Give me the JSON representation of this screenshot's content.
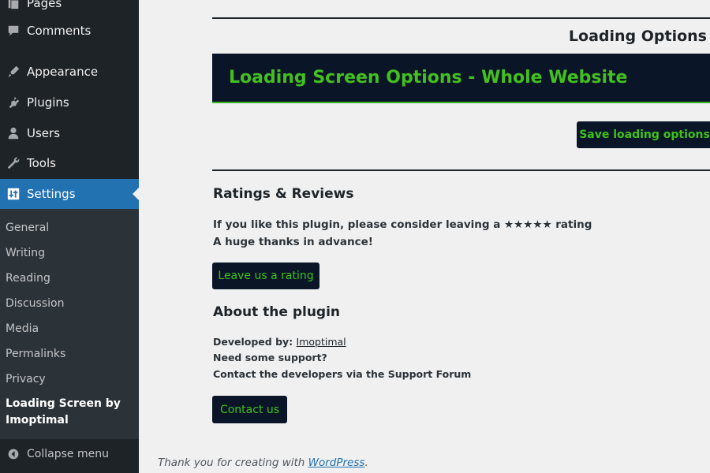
{
  "sidebar": {
    "items": [
      {
        "label": "Pages",
        "icon": "pages-icon"
      },
      {
        "label": "Comments",
        "icon": "comments-icon"
      },
      {
        "label": "Appearance",
        "icon": "appearance-icon"
      },
      {
        "label": "Plugins",
        "icon": "plugins-icon"
      },
      {
        "label": "Users",
        "icon": "users-icon"
      },
      {
        "label": "Tools",
        "icon": "tools-icon"
      },
      {
        "label": "Settings",
        "icon": "settings-icon"
      }
    ],
    "submenu": [
      "General",
      "Writing",
      "Reading",
      "Discussion",
      "Media",
      "Permalinks",
      "Privacy"
    ],
    "current_sub": {
      "line1": "Loading Screen by",
      "line2": "Imoptimal"
    },
    "collapse_label": "Collapse menu"
  },
  "main": {
    "options_title": "Loading Options",
    "banner_title": "Loading Screen Options - Whole Website",
    "save_button": "Save loading options",
    "ratings": {
      "heading": "Ratings & Reviews",
      "line1": "If you like this plugin, please consider leaving a ★★★★★ rating",
      "line2": "A huge thanks in advance!",
      "button": "Leave us a rating"
    },
    "about": {
      "heading": "About the plugin",
      "developed_by": "Developed by:",
      "developer_link": "Imoptimal",
      "need_support": "Need some support?",
      "contact_text": "Contact the developers via the Support Forum",
      "button": "Contact us"
    }
  },
  "footer": {
    "text": "Thank you for creating with",
    "link": "WordPress",
    "period": "."
  },
  "colors": {
    "sidebar_bg": "#1d2327",
    "active_bg": "#2271b1",
    "banner_bg": "#0a1628",
    "accent_green": "#43c01f"
  }
}
